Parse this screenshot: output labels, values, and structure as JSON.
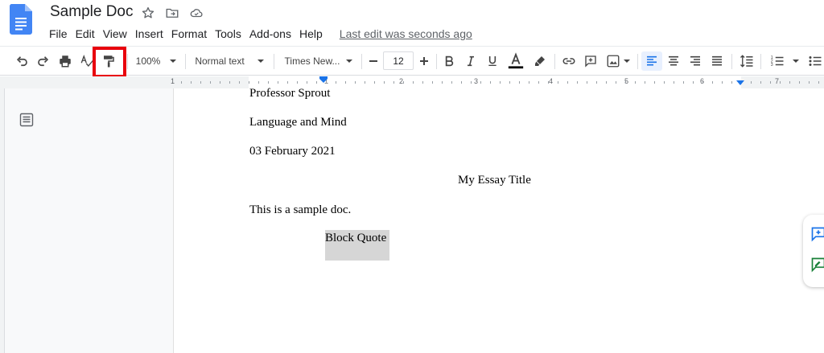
{
  "header": {
    "title": "Sample Doc",
    "last_edit": "Last edit was seconds ago",
    "menu": [
      "File",
      "Edit",
      "View",
      "Insert",
      "Format",
      "Tools",
      "Add-ons",
      "Help"
    ]
  },
  "toolbar": {
    "zoom": "100%",
    "style": "Normal text",
    "font": "Times New...",
    "font_size": "12",
    "active_tool": "paint-format"
  },
  "ruler": {
    "numbers": [
      "1",
      "1",
      "2",
      "3",
      "4",
      "5",
      "6",
      "7"
    ]
  },
  "document": {
    "lines": [
      "Professor Sprout",
      "Language and Mind",
      "03 February 2021"
    ],
    "essay_title": "My Essay Title",
    "body": "This is a sample doc.",
    "block_quote": "Block Quote"
  },
  "colors": {
    "accent": "#1a73e8",
    "highlight_box": "#e8000d",
    "selection": "#d6d6d6"
  }
}
